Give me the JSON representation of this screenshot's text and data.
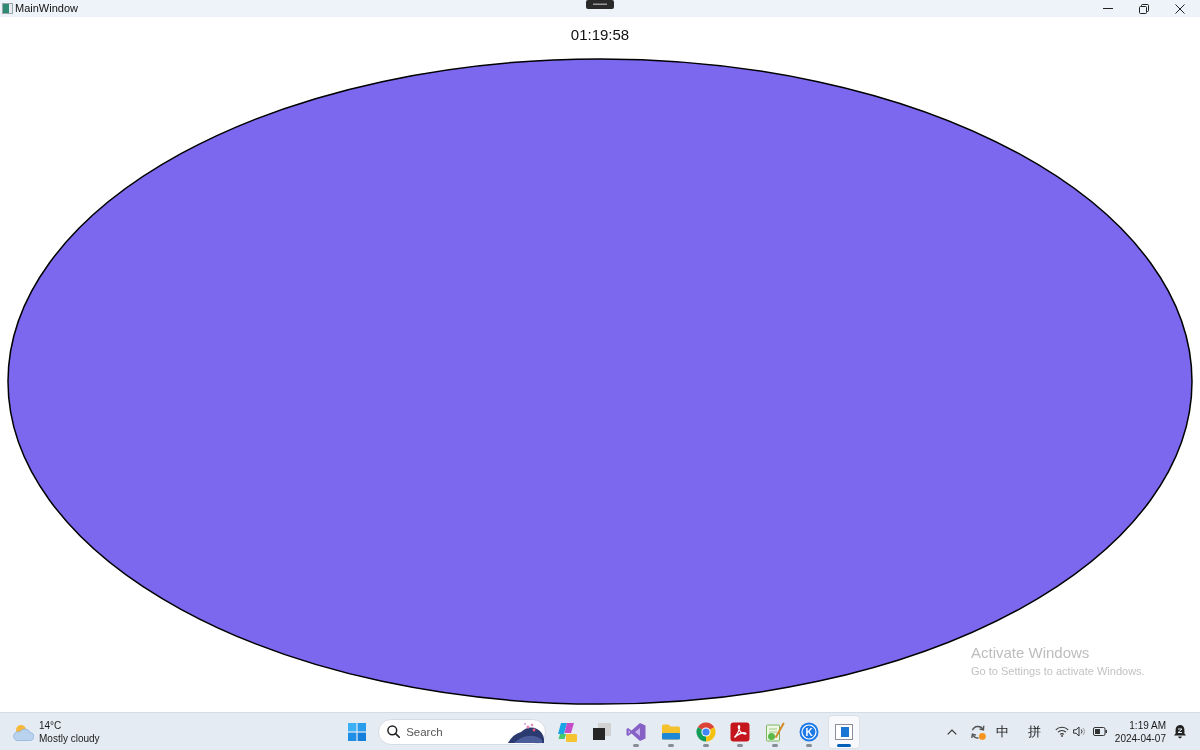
{
  "window": {
    "title": "MainWindow"
  },
  "clock": "01:19:58",
  "activation_notice": {
    "title": "Activate Windows",
    "message": "Go to Settings to activate Windows."
  },
  "taskbar": {
    "weather": {
      "temperature": "14°C",
      "condition": "Mostly cloudy"
    },
    "search": {
      "placeholder": "Search"
    },
    "apps": [
      {
        "kind": "shapes",
        "running": false,
        "selected": false
      },
      {
        "kind": "squares",
        "running": false,
        "selected": false
      },
      {
        "kind": "ribbon",
        "running": true,
        "selected": false
      },
      {
        "kind": "folder",
        "running": true,
        "selected": false
      },
      {
        "kind": "browser",
        "running": true,
        "selected": false
      },
      {
        "kind": "pdf",
        "running": true,
        "selected": false
      },
      {
        "kind": "notepad",
        "running": true,
        "selected": false
      },
      {
        "kind": "letter",
        "label": "K",
        "running": true,
        "selected": false
      },
      {
        "kind": "window",
        "running": true,
        "selected": true
      }
    ],
    "tray": {
      "input_mode": "中",
      "ime": "拼",
      "time": "1:19 AM",
      "date": "2024-04-07"
    }
  }
}
